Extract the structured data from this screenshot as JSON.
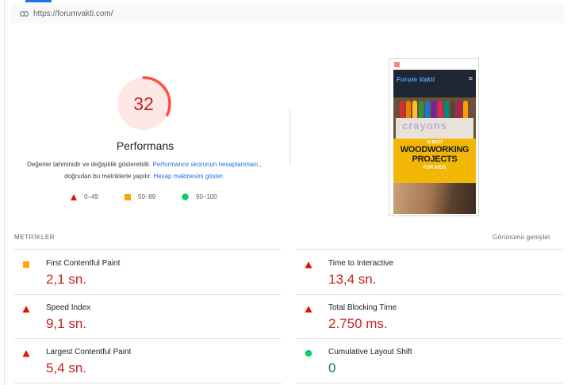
{
  "url": "https://forumvakti.com/",
  "icons": {
    "url_icon": "link-icon",
    "fail": "red-triangle",
    "average": "orange-square",
    "pass": "green-circle"
  },
  "colors": {
    "fail": "#eb0f00",
    "average": "#ffa400",
    "pass": "#0cce6b",
    "link": "#1a73e8",
    "score_ring": "#ff4e42",
    "score_bg": "#fde8e6"
  },
  "summary": {
    "score": "32",
    "score_value": 32,
    "title": "Performans",
    "desc_1": "Değerler tahminidir ve değişiklik gösterebilir.",
    "desc_link_1": "Performance skorunun hesaplanması",
    "desc_2": ", doğrudan bu metriklerle yapılır.",
    "desc_link_2": "Hesap makinesini göster."
  },
  "legend": [
    {
      "icon": "red-triangle",
      "label": "0–49"
    },
    {
      "icon": "orange-square",
      "label": "50–89"
    },
    {
      "icon": "green-circle",
      "label": "90–100"
    }
  ],
  "screenshot": {
    "site_name": "Forum Vakti",
    "menu_glyph": "≡",
    "crayons_text": "crayons",
    "line1": "20 BEST",
    "line2": "WOODWORKING",
    "line3": "PROJECTS",
    "line4": "FOR KIDS"
  },
  "metrics_section": {
    "heading": "METRİKLER",
    "expand_label": "Görünümü genişlet"
  },
  "metrics": [
    {
      "name": "First Contentful Paint",
      "value": "2,1 sn.",
      "rating": "average"
    },
    {
      "name": "Time to Interactive",
      "value": "13,4 sn.",
      "rating": "fail"
    },
    {
      "name": "Speed Index",
      "value": "9,1 sn.",
      "rating": "fail"
    },
    {
      "name": "Total Blocking Time",
      "value": "2.750 ms.",
      "rating": "fail"
    },
    {
      "name": "Largest Contentful Paint",
      "value": "5,4 sn.",
      "rating": "fail"
    },
    {
      "name": "Cumulative Layout Shift",
      "value": "0",
      "rating": "pass"
    }
  ]
}
